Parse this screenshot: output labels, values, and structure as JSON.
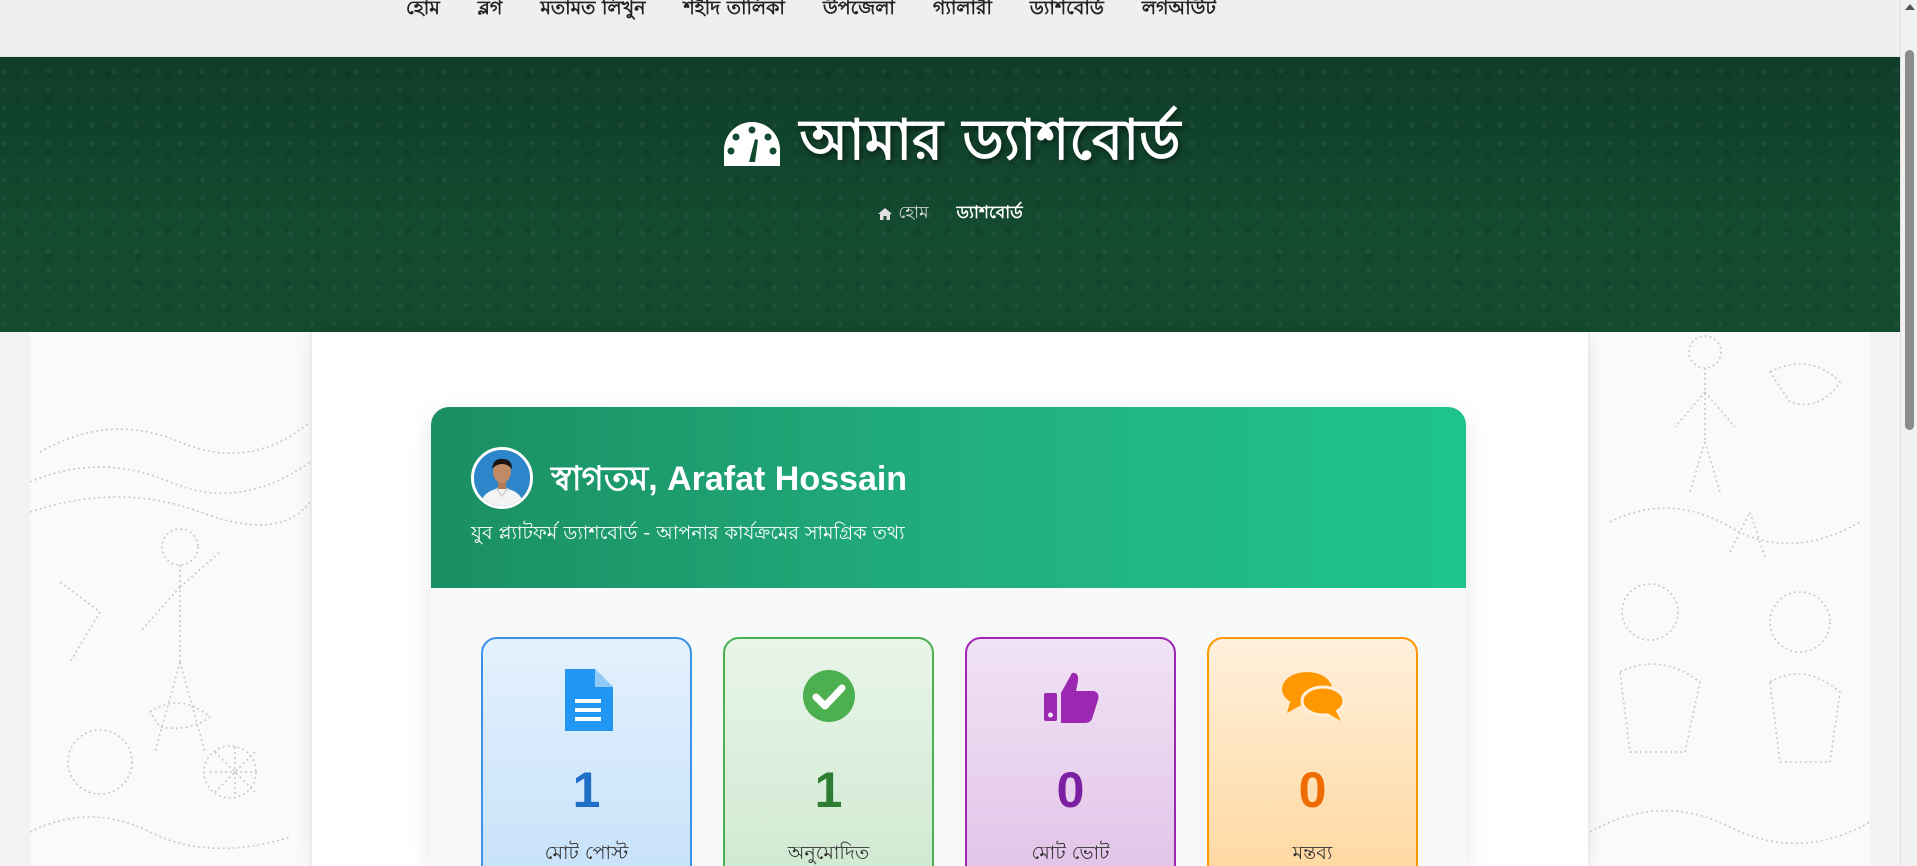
{
  "nav": {
    "items": [
      "হোম",
      "ব্লগ",
      "মতামত লিখুন",
      "শহীদ তালিকা",
      "উপজেলা",
      "গ্যালারী",
      "ড্যাশবোর্ড",
      "লগআউট"
    ]
  },
  "hero": {
    "title": "আমার ড্যাশবোর্ড",
    "icon": "tachometer-icon",
    "breadcrumb": {
      "home": "হোম",
      "current": "ড্যাশবোর্ড"
    }
  },
  "dashboard": {
    "welcome": "স্বাগতম, Arafat Hossain",
    "subtitle": "যুব প্ল্যাটফর্ম ড্যাশবোর্ড - আপনার কার্যক্রমের সামগ্রিক তথ্য",
    "stats": [
      {
        "value": "1",
        "label": "মোট পোস্ট",
        "icon": "document-icon",
        "color": "#2196f3"
      },
      {
        "value": "1",
        "label": "অনুমোদিত",
        "icon": "check-circle-icon",
        "color": "#4caf50"
      },
      {
        "value": "0",
        "label": "মোট ভোট",
        "icon": "thumbs-up-icon",
        "color": "#9c27b0"
      },
      {
        "value": "0",
        "label": "মন্তব্য",
        "icon": "comments-icon",
        "color": "#ff9800"
      }
    ]
  },
  "colors": {
    "hero_bg": "#13492f",
    "card_header": "#22b07f"
  }
}
